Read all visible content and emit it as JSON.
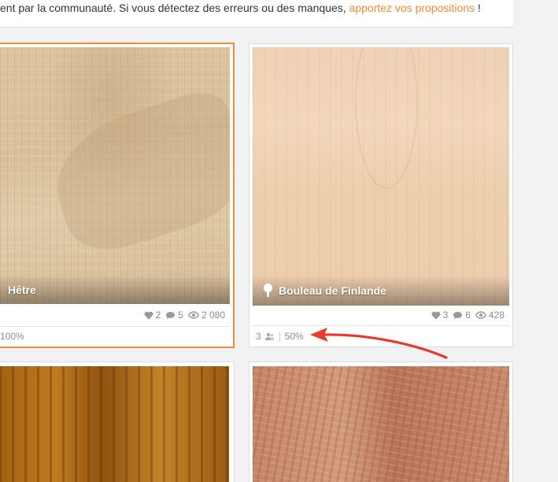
{
  "notice": {
    "text": "ent par la communauté. Si vous détectez des erreurs ou des manques, ",
    "link": "apportez vos propositions",
    "suffix": " !"
  },
  "cards": [
    {
      "name": "Hêtre",
      "likes": "2",
      "comments": "5",
      "views": "2 080",
      "completion": "100%",
      "selected": true
    },
    {
      "name": "Bouleau de Finlande",
      "likes": "3",
      "comments": "6",
      "views": "428",
      "contributors": "3",
      "completion": "50%",
      "icon": "tree-icon"
    },
    {
      "name": ""
    },
    {
      "name": ""
    }
  ],
  "colors": {
    "accent": "#f08a3c",
    "arrow": "#e8392c",
    "meta_text": "#8c8c8c"
  }
}
